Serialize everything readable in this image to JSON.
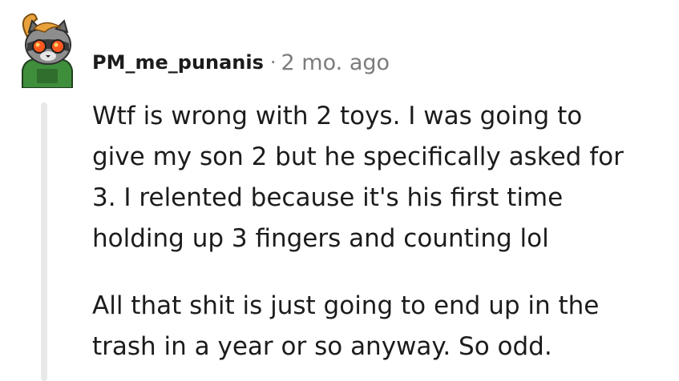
{
  "comment": {
    "author": "PM_me_punanis",
    "separator": "·",
    "age": "2 mo. ago",
    "paragraphs": [
      {
        "lines": [
          "Wtf is wrong with 2 toys. I was going to",
          "give my son 2 but he specifically asked for",
          "3. I relented because it's his first time",
          "holding up 3 fingers and counting lol"
        ]
      },
      {
        "lines": [
          "All that shit is just going to end up in the",
          "trash in a year or so anyway. So odd."
        ]
      }
    ],
    "avatar_icon": "raccoon-avatar-icon"
  },
  "colors": {
    "text": "#1c1c1c",
    "meta": "#7c7c7c",
    "thread_line": "#e8e8e8",
    "avatar_hair": "#e9a23b",
    "avatar_fur": "#8d8d8d",
    "avatar_goggles": "#ff5a1f",
    "avatar_shirt": "#3f8e3c"
  }
}
